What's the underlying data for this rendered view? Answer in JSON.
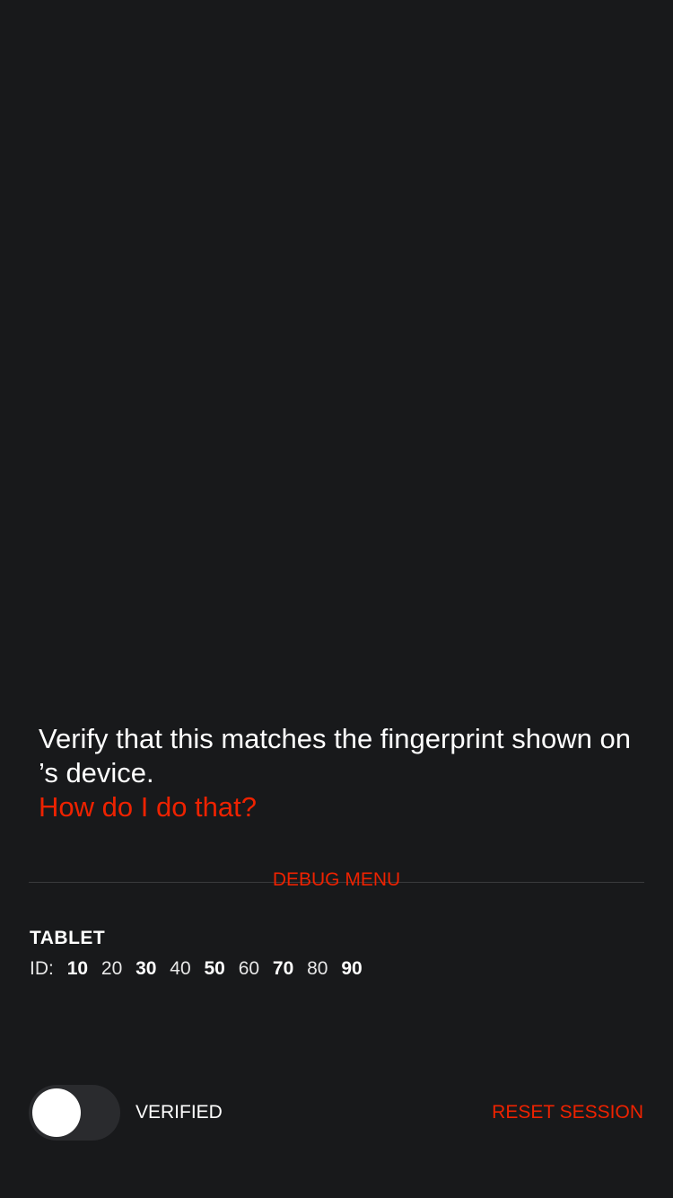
{
  "verification": {
    "instruction": "Verify that this matches the fingerprint shown on ’s device.",
    "help_link": "How do I do that?"
  },
  "debug_menu": {
    "label": "DEBUG MENU",
    "device_name": "TABLET",
    "id_label": "ID:",
    "id_groups": [
      {
        "text": "10",
        "bold": true
      },
      {
        "text": "20",
        "bold": false
      },
      {
        "text": "30",
        "bold": true
      },
      {
        "text": "40",
        "bold": false
      },
      {
        "text": "50",
        "bold": true
      },
      {
        "text": "60",
        "bold": false
      },
      {
        "text": "70",
        "bold": true
      },
      {
        "text": "80",
        "bold": false
      },
      {
        "text": "90",
        "bold": true
      }
    ]
  },
  "footer": {
    "verified_label": "VERIFIED",
    "verified_on": false,
    "reset_label": "RESET SESSION"
  },
  "colors": {
    "accent": "#ee2200",
    "background": "#18191b"
  }
}
